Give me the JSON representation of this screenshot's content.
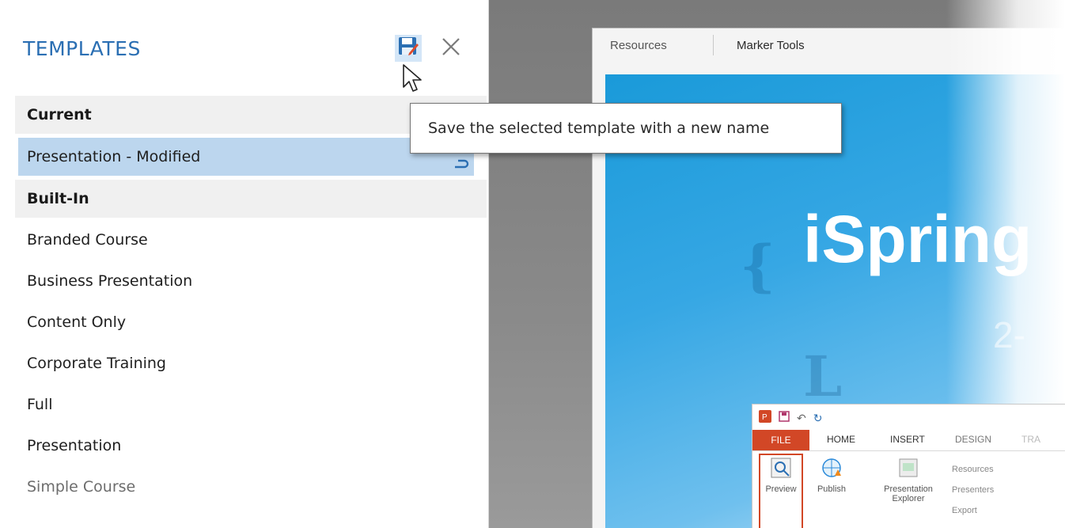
{
  "panel": {
    "title": "TEMPLATES",
    "toolbar": {
      "save_icon": "save-as-icon",
      "close_icon": "close-icon"
    },
    "sections": [
      {
        "label": "Current",
        "items": [
          {
            "label": "Presentation - Modified",
            "selected": true,
            "action_icon": "reset-icon"
          }
        ]
      },
      {
        "label": "Built-In",
        "items": [
          {
            "label": "Branded Course"
          },
          {
            "label": "Business Presentation"
          },
          {
            "label": "Content Only"
          },
          {
            "label": "Corporate Training"
          },
          {
            "label": "Full"
          },
          {
            "label": "Presentation"
          },
          {
            "label": "Simple Course"
          }
        ]
      }
    ]
  },
  "tooltip": {
    "text": "Save the selected template with a new name"
  },
  "player": {
    "tabs": [
      "Resources",
      "Marker Tools"
    ],
    "slide": {
      "title": "iSpring",
      "subtitle": "2-"
    }
  },
  "ribbon": {
    "tabs": [
      "FILE",
      "HOME",
      "INSERT",
      "DESIGN",
      "TRA"
    ],
    "buttons": [
      "Preview",
      "Publish",
      "Presentation Explorer"
    ],
    "side_items": [
      "Resources",
      "Presenters",
      "Export"
    ]
  },
  "colors": {
    "accent": "#2b6fb3",
    "selected_row": "#bcd6ee",
    "section_bg": "#f0f0f0",
    "file_tab": "#d24726"
  }
}
